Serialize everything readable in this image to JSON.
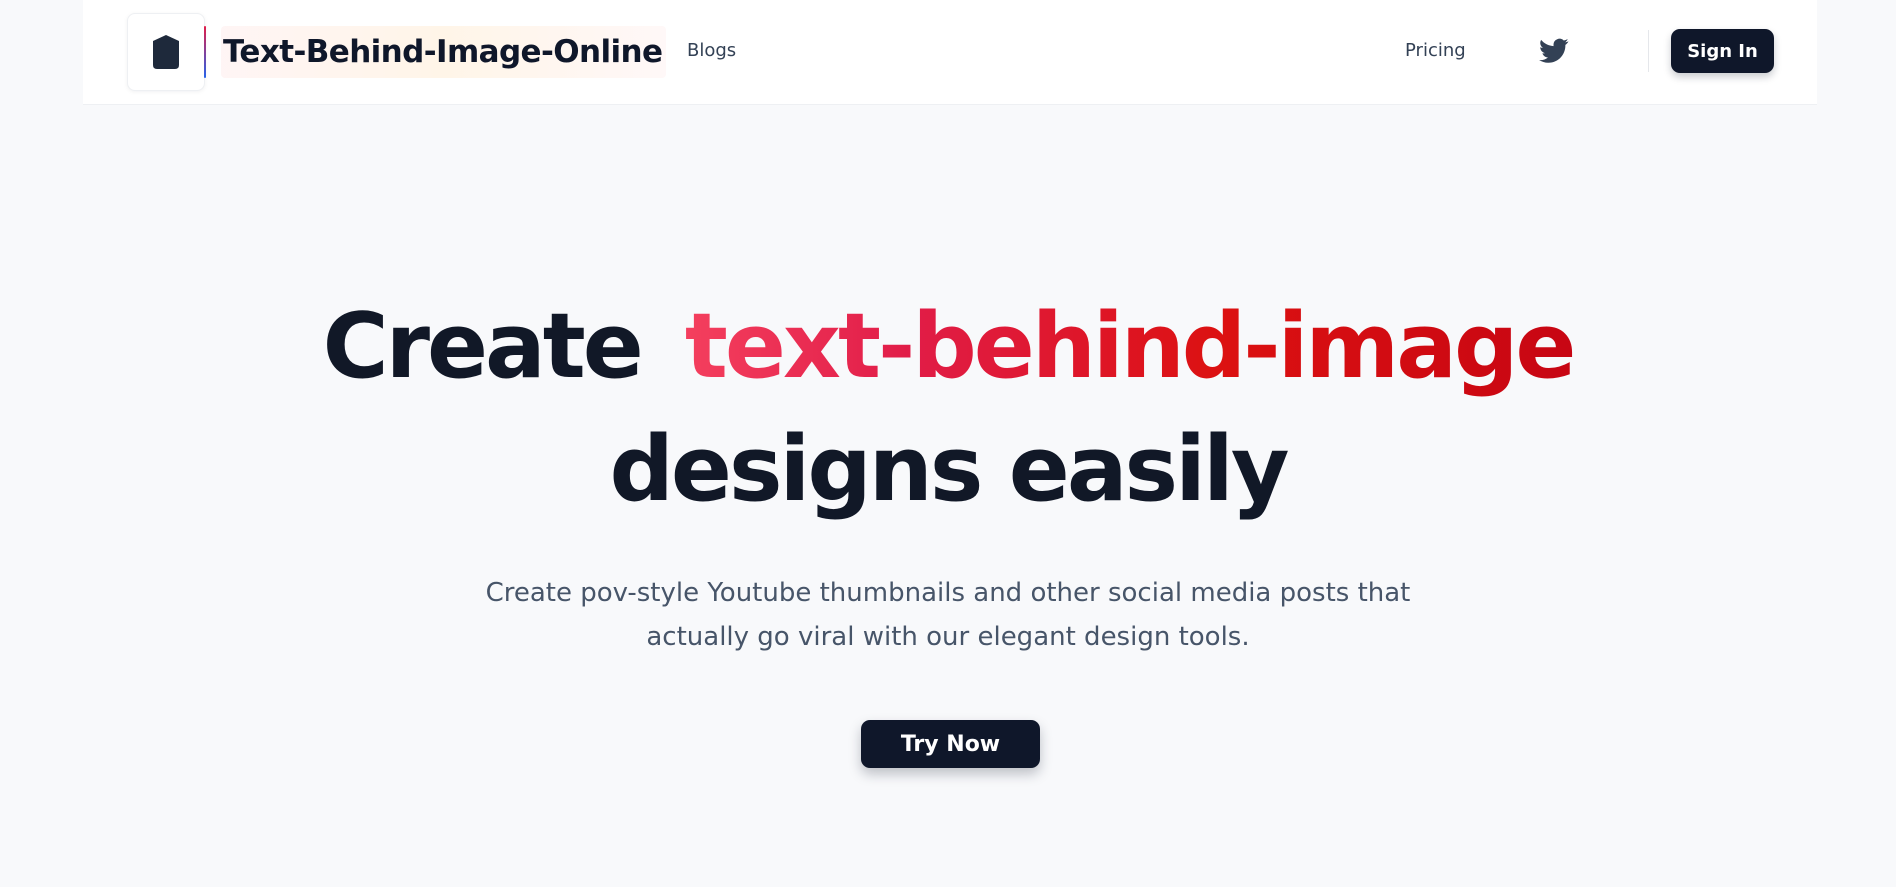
{
  "header": {
    "brand_name": "Text-Behind-Image-Online",
    "nav": {
      "blogs": "Blogs",
      "pricing": "Pricing"
    },
    "sign_in_label": "Sign In"
  },
  "hero": {
    "headline_part1": "Create",
    "headline_highlight": "text-behind-image",
    "headline_part2": "designs easily",
    "subtitle_line1": "Create pov-style Youtube thumbnails and other social media posts that",
    "subtitle_line2": "actually go viral with our elegant design tools.",
    "cta_label": "Try Now"
  },
  "colors": {
    "primary_dark": "#0f172a",
    "highlight_start": "#f43f5e",
    "highlight_end": "#c70613",
    "background": "#f8f9fb",
    "body_text": "#475569"
  },
  "icons": {
    "logo": "shield-icon",
    "social": "twitter-icon"
  }
}
